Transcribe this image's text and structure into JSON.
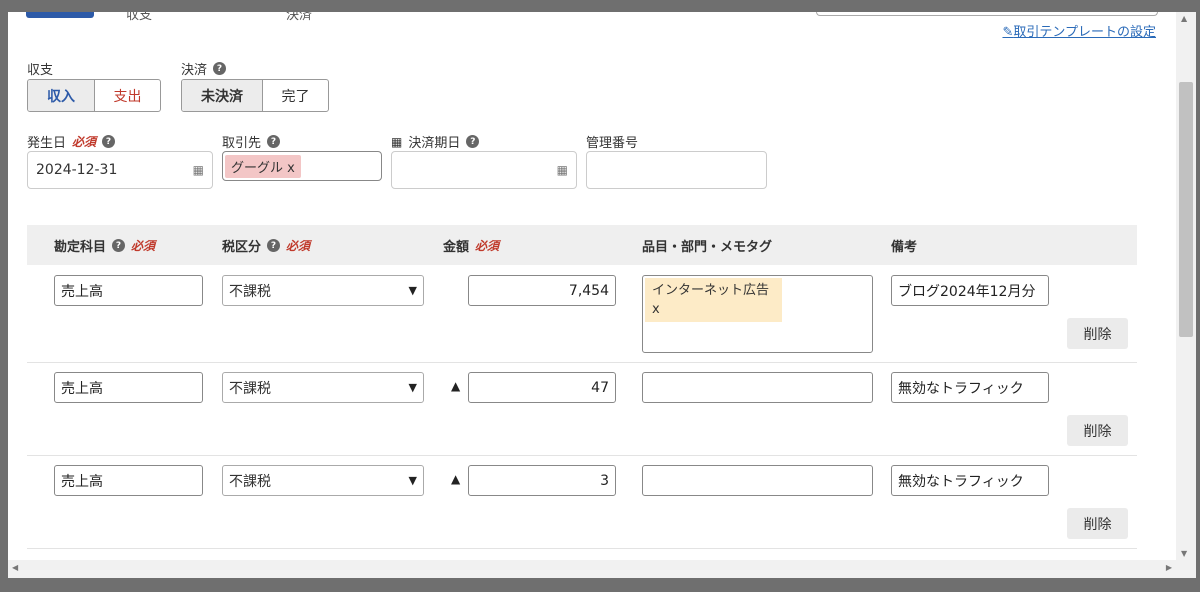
{
  "top_strip": {
    "income_expense_partial": "収支",
    "settlement_partial": "決済"
  },
  "template_link": "取引テンプレートの設定",
  "income_expense": {
    "label": "収支",
    "options": [
      "収入",
      "支出"
    ],
    "selected": "収入"
  },
  "settlement": {
    "label": "決済",
    "options": [
      "未決済",
      "完了"
    ],
    "selected": "未決済"
  },
  "occurrence_date": {
    "label": "発生日",
    "required": "必須",
    "value": "2024-12-31"
  },
  "partner": {
    "label": "取引先",
    "tag": "グーグル x"
  },
  "due_date": {
    "label": "決済期日",
    "value": ""
  },
  "management_number": {
    "label": "管理番号",
    "value": ""
  },
  "table": {
    "headers": {
      "account": "勘定科目",
      "tax": "税区分",
      "amount": "金額",
      "tags": "品目・部門・メモタグ",
      "remarks": "備考",
      "required": "必須"
    },
    "rows": [
      {
        "account": "売上高",
        "tax": "不課税",
        "minus": "",
        "amount": "7,454",
        "tag_line1": "インターネット広告",
        "tag_line2": "x",
        "remarks": "ブログ2024年12月分",
        "delete": "削除"
      },
      {
        "account": "売上高",
        "tax": "不課税",
        "minus": "▲",
        "amount": "47",
        "tag_line1": "",
        "tag_line2": "",
        "remarks": "無効なトラフィック",
        "delete": "削除"
      },
      {
        "account": "売上高",
        "tax": "不課税",
        "minus": "▲",
        "amount": "3",
        "tag_line1": "",
        "tag_line2": "",
        "remarks": "無効なトラフィック",
        "delete": "削除"
      }
    ]
  },
  "colors": {
    "link": "#2a6ab8",
    "required": "#c0392b",
    "income_active": "#2d5aa8",
    "expense": "#c0392b",
    "tag_bg": "#fdebc7",
    "partner_chip_bg": "#f3c6c6"
  },
  "icons": {
    "help": "question-circle-icon",
    "calendar": "calendar-icon",
    "edit": "edit-icon",
    "select": "chevron-down-icon",
    "minus": "triangle-up-icon"
  }
}
